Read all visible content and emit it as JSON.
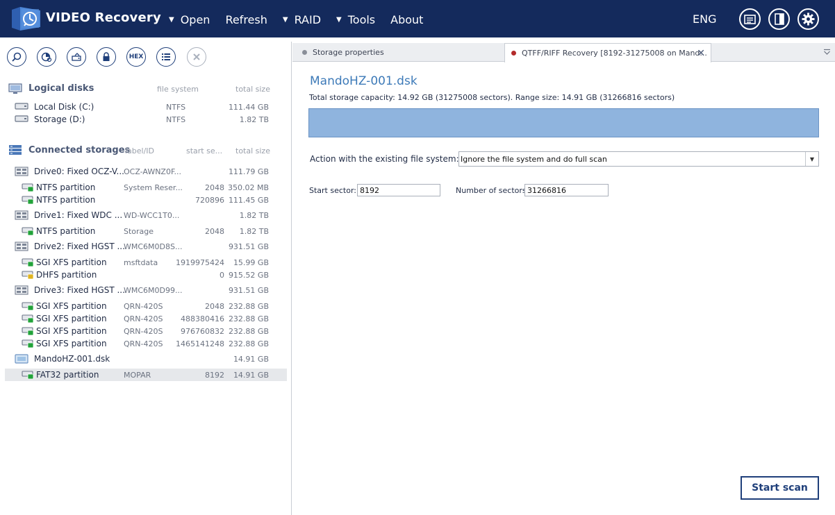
{
  "app": {
    "title": "VIDEO Recovery"
  },
  "menu": [
    {
      "label": "Open",
      "has_caret": true
    },
    {
      "label": "Refresh",
      "has_caret": false
    },
    {
      "label": "RAID",
      "has_caret": true
    },
    {
      "label": "Tools",
      "has_caret": true
    },
    {
      "label": "About",
      "has_caret": false
    }
  ],
  "header": {
    "language": "ENG",
    "buttons": [
      "log-icon",
      "panel-icon",
      "settings-icon"
    ]
  },
  "toolbar": {
    "buttons": [
      "search-icon",
      "chart-icon",
      "image-icon",
      "lock-icon",
      "hex-icon",
      "list-icon",
      "close-icon"
    ],
    "hex_label": "HEX"
  },
  "logical_disks": {
    "title": "Logical disks",
    "columns": {
      "fs": "file system",
      "size": "total size"
    },
    "items": [
      {
        "name": "Local Disk (C:)",
        "fs": "NTFS",
        "size": "111.44 GB"
      },
      {
        "name": "Storage (D:)",
        "fs": "NTFS",
        "size": "1.82 TB"
      }
    ]
  },
  "storages": {
    "title": "Connected storages",
    "columns": {
      "label": "label/ID",
      "start": "start se...",
      "size": "total size"
    },
    "items": [
      {
        "kind": "drive",
        "name": "Drive0: Fixed OCZ-V...",
        "label": "OCZ-AWNZ0F...",
        "start": "",
        "size": "111.79 GB"
      },
      {
        "kind": "part",
        "name": "NTFS partition",
        "label": "System Reser...",
        "start": "2048",
        "size": "350.02 MB"
      },
      {
        "kind": "part",
        "name": "NTFS partition",
        "label": "",
        "start": "720896",
        "size": "111.45 GB"
      },
      {
        "kind": "drive",
        "name": "Drive1: Fixed WDC ...",
        "label": "WD-WCC1T0...",
        "start": "",
        "size": "1.82 TB"
      },
      {
        "kind": "part",
        "name": "NTFS partition",
        "label": "Storage",
        "start": "2048",
        "size": "1.82 TB"
      },
      {
        "kind": "drive",
        "name": "Drive2: Fixed HGST ...",
        "label": "WMC6M0D8S...",
        "start": "",
        "size": "931.51 GB"
      },
      {
        "kind": "part",
        "name": "SGI XFS partition",
        "label": "msftdata",
        "start": "1919975424",
        "size": "15.99 GB"
      },
      {
        "kind": "part-y",
        "name": "DHFS partition",
        "label": "",
        "start": "0",
        "size": "915.52 GB"
      },
      {
        "kind": "drive",
        "name": "Drive3: Fixed HGST ...",
        "label": "WMC6M0D99...",
        "start": "",
        "size": "931.51 GB"
      },
      {
        "kind": "part",
        "name": "SGI XFS partition",
        "label": "QRN-420S",
        "start": "2048",
        "size": "232.88 GB"
      },
      {
        "kind": "part",
        "name": "SGI XFS partition",
        "label": "QRN-420S",
        "start": "488380416",
        "size": "232.88 GB"
      },
      {
        "kind": "part",
        "name": "SGI XFS partition",
        "label": "QRN-420S",
        "start": "976760832",
        "size": "232.88 GB"
      },
      {
        "kind": "part",
        "name": "SGI XFS partition",
        "label": "QRN-420S",
        "start": "1465141248",
        "size": "232.88 GB"
      },
      {
        "kind": "image",
        "name": "MandoHZ-001.dsk",
        "label": "",
        "start": "",
        "size": "14.91 GB"
      },
      {
        "kind": "part",
        "name": "FAT32 partition",
        "label": "MOPAR",
        "start": "8192",
        "size": "14.91 GB",
        "selected": true
      }
    ]
  },
  "tabs": [
    {
      "label": "Storage properties",
      "dot_color": "#8a8f99",
      "active": false
    },
    {
      "label": "QTFF/RIFF Recovery [8192-31275008 on Mand...",
      "dot_color": "#b32b2b",
      "active": true
    }
  ],
  "scan": {
    "title": "MandoHZ-001.dsk",
    "subtitle": "Total storage capacity: 14.92 GB (31275008 sectors). Range size: 14.91 GB (31266816 sectors)",
    "action_label": "Action with the existing file system:",
    "action_value": "Ignore the file system and do full scan",
    "start_label": "Start sector:",
    "start_value": "8192",
    "count_label": "Number of sectors:",
    "count_value": "31266816",
    "start_button": "Start scan"
  },
  "colors": {
    "header_bg": "#142a5c",
    "accent": "#3d7ab8",
    "range_bar": "#8fb4de",
    "partition_green": "#22a33a",
    "partition_yellow": "#e0b420"
  }
}
